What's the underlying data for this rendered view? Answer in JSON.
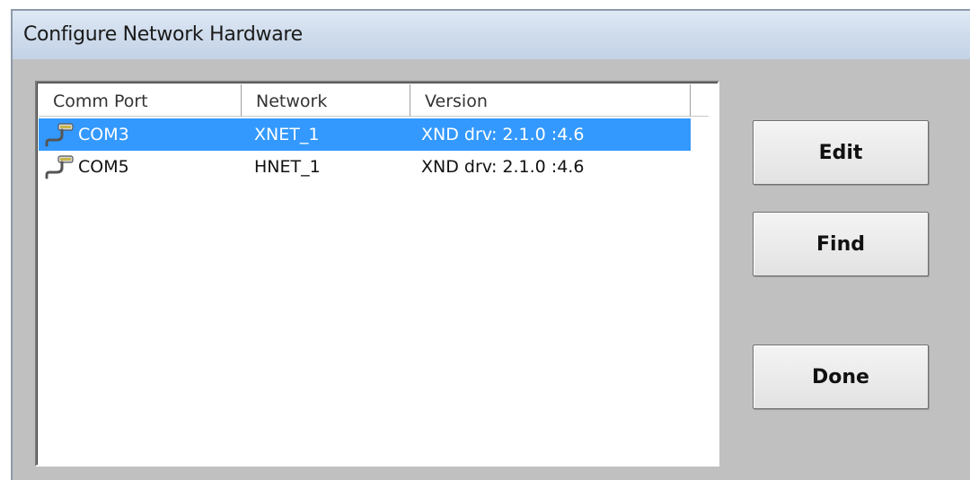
{
  "window": {
    "title": "Configure Network Hardware"
  },
  "list": {
    "columns": [
      "Comm Port",
      "Network",
      "Version",
      ""
    ],
    "rows": [
      {
        "port": "COM3",
        "network": "XNET_1",
        "version": "XND drv: 2.1.0 :4.6",
        "selected": true,
        "icon": "serial-port-icon"
      },
      {
        "port": "COM5",
        "network": "HNET_1",
        "version": "XND drv: 2.1.0 :4.6",
        "selected": false,
        "icon": "serial-port-icon"
      }
    ]
  },
  "buttons": {
    "edit": "Edit",
    "find": "Find",
    "done": "Done"
  },
  "colors": {
    "selection": "#3399ff",
    "dialog_bg": "#c0c0c0",
    "titlebar": "#cfdcec"
  }
}
